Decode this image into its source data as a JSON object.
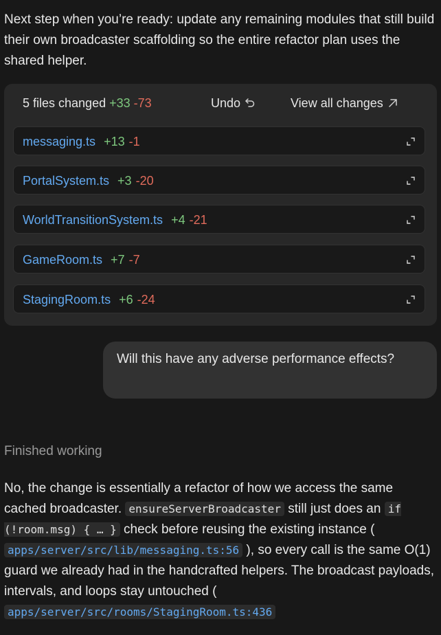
{
  "intro": {
    "text": "Next step when you’re ready: update any remaining modules that still build their own broadcaster scaffolding so the entire refactor plan uses the shared helper."
  },
  "changes": {
    "count_label": "5 files changed",
    "added": "+33",
    "removed": "-73",
    "undo_label": "Undo",
    "view_all_label": "View all changes",
    "files": [
      {
        "name": "messaging.ts",
        "added": "+13",
        "removed": "-1"
      },
      {
        "name": "PortalSystem.ts",
        "added": "+3",
        "removed": "-20"
      },
      {
        "name": "WorldTransitionSystem.ts",
        "added": "+4",
        "removed": "-21"
      },
      {
        "name": "GameRoom.ts",
        "added": "+7",
        "removed": "-7"
      },
      {
        "name": "StagingRoom.ts",
        "added": "+6",
        "removed": "-24"
      }
    ]
  },
  "user_message": {
    "text": "Will this have any adverse performance effects?"
  },
  "status": {
    "text": "Finished working"
  },
  "answer": {
    "part1": "No, the change is essentially a refactor of how we access the same cached broadcaster. ",
    "code1": "ensureServerBroadcaster",
    "part2": " still just does an ",
    "code2": "if (!room.msg) { … }",
    "part3": " check before reusing the existing instance ( ",
    "link1": "apps/server/src/lib/messaging.ts:56",
    "part4": " ), so every call is the same O(1) guard we already had in the handcrafted helpers. The broadcast payloads, intervals, and loops stay untouched ( ",
    "link2": "apps/server/src/rooms/StagingRoom.ts:436"
  },
  "colors": {
    "background": "#181818",
    "card": "#282828",
    "row": "#191919",
    "link": "#63a9f0",
    "added": "#7ec87e",
    "removed": "#e06b5b"
  },
  "icons": {
    "undo": "undo-arrow-icon",
    "view_all": "arrow-up-right-icon",
    "expand": "expand-icon"
  }
}
